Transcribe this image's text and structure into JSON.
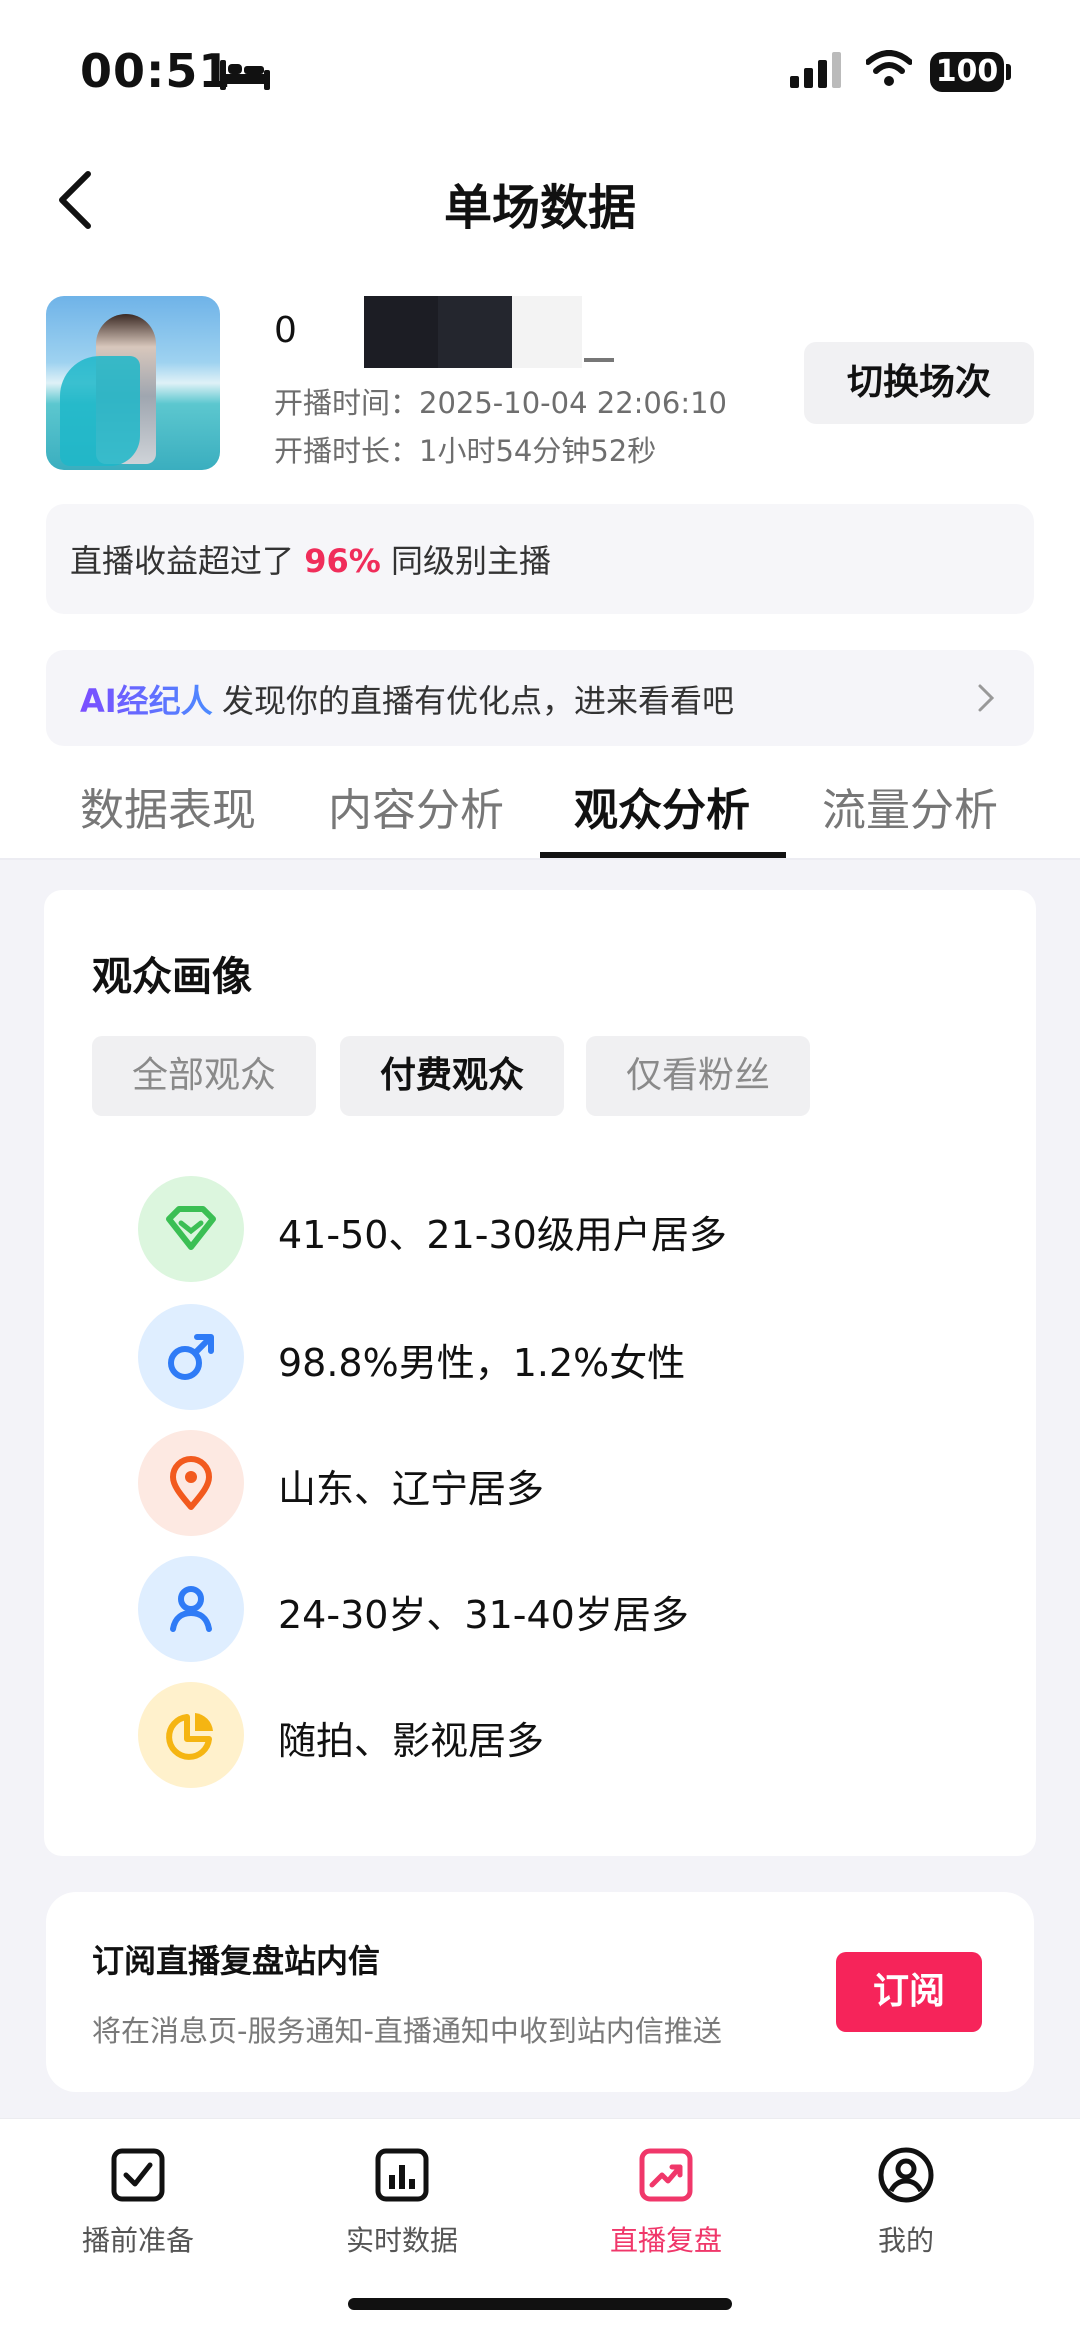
{
  "status_bar": {
    "time": "00:51",
    "battery": "100"
  },
  "header": {
    "title": "单场数据"
  },
  "profile": {
    "name_visible": "0",
    "start_time": "开播时间：2025-10-04 22:06:10",
    "duration": "开播时长：1小时54分钟52秒",
    "switch_label": "切换场次"
  },
  "earnings": {
    "prefix": "直播收益超过了 ",
    "percent": "96%",
    "suffix": " 同级别主播"
  },
  "ai_banner": {
    "tag": "AI经纪人",
    "text": "发现你的直播有优化点，进来看看吧"
  },
  "tabs": [
    "数据表现",
    "内容分析",
    "观众分析",
    "流量分析"
  ],
  "active_tab": "观众分析",
  "portrait": {
    "title": "观众画像",
    "filters": [
      "全部观众",
      "付费观众",
      "仅看粉丝"
    ],
    "active_filter": "付费观众",
    "traits": [
      {
        "icon": "diamond-icon",
        "text": "41-50、21-30级用户居多",
        "color": "#3bbf54"
      },
      {
        "icon": "male-icon",
        "text": "98.8%男性，1.2%女性",
        "color": "#2f7bf6"
      },
      {
        "icon": "location-pin-icon",
        "text": "山东、辽宁居多",
        "color": "#f25a1e"
      },
      {
        "icon": "user-icon",
        "text": "24-30岁、31-40岁居多",
        "color": "#2f7bf6"
      },
      {
        "icon": "pie-chart-icon",
        "text": "随拍、影视居多",
        "color": "#f5b512"
      }
    ]
  },
  "subscribe": {
    "title": "订阅直播复盘站内信",
    "desc": "将在消息页-服务通知-直播通知中收到站内信推送",
    "button": "订阅"
  },
  "bottom_nav": [
    {
      "label": "播前准备",
      "icon": "checkbox-icon"
    },
    {
      "label": "实时数据",
      "icon": "bar-chart-icon"
    },
    {
      "label": "直播复盘",
      "icon": "trend-icon"
    },
    {
      "label": "我的",
      "icon": "profile-icon"
    }
  ],
  "active_nav": "直播复盘",
  "colors": {
    "accent": "#f6245a",
    "tab_active": "#111111",
    "earn_highlight": "#f02d5a"
  }
}
